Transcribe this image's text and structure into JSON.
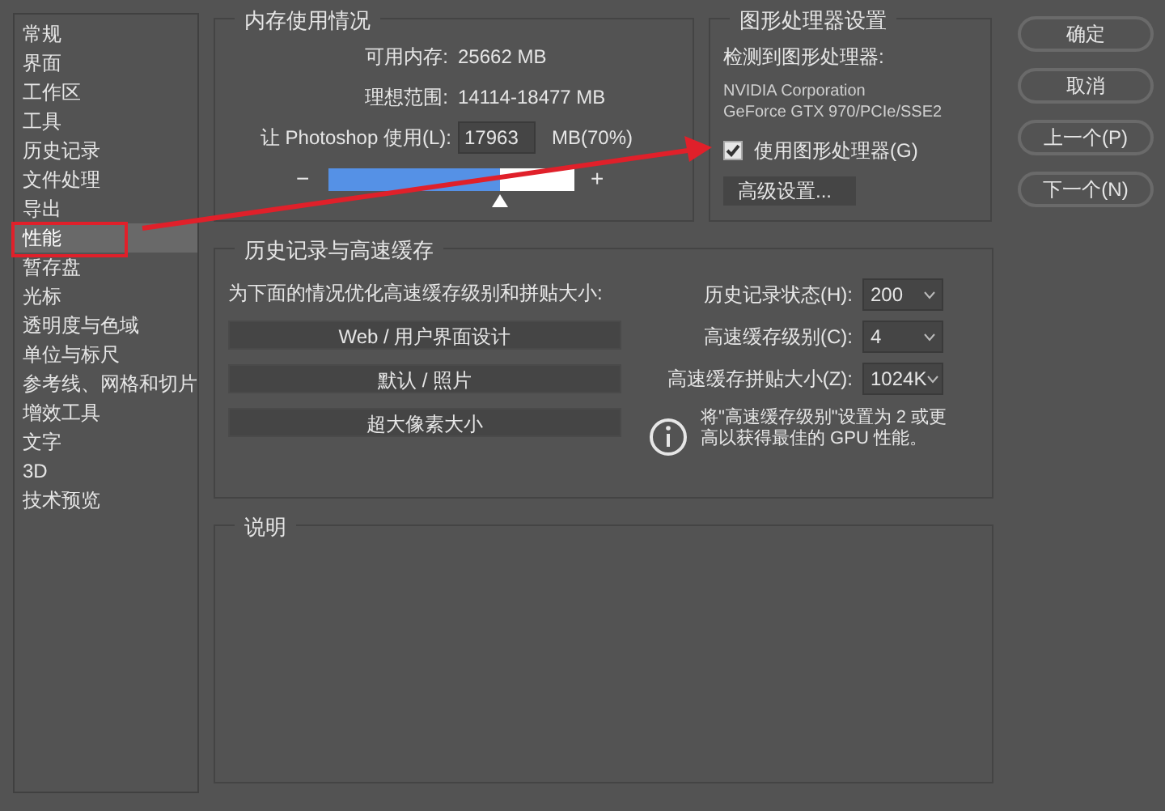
{
  "sidebar": {
    "items": [
      {
        "label": "常规",
        "selected": false
      },
      {
        "label": "界面",
        "selected": false
      },
      {
        "label": "工作区",
        "selected": false
      },
      {
        "label": "工具",
        "selected": false
      },
      {
        "label": "历史记录",
        "selected": false
      },
      {
        "label": "文件处理",
        "selected": false
      },
      {
        "label": "导出",
        "selected": false
      },
      {
        "label": "性能",
        "selected": true
      },
      {
        "label": "暂存盘",
        "selected": false
      },
      {
        "label": "光标",
        "selected": false
      },
      {
        "label": "透明度与色域",
        "selected": false
      },
      {
        "label": "单位与标尺",
        "selected": false
      },
      {
        "label": "参考线、网格和切片",
        "selected": false
      },
      {
        "label": "增效工具",
        "selected": false
      },
      {
        "label": "文字",
        "selected": false
      },
      {
        "label": "3D",
        "selected": false
      },
      {
        "label": "技术预览",
        "selected": false
      }
    ]
  },
  "memory": {
    "title": "内存使用情况",
    "rows": [
      {
        "label": "可用内存:",
        "value": "25662 MB"
      },
      {
        "label": "理想范围:",
        "value": "14114-18477 MB"
      }
    ],
    "use_label": "让 Photoshop 使用(L):",
    "use_value": "17963",
    "use_unit": "MB(70%)",
    "minus": "−",
    "plus": "+",
    "level": 0.7
  },
  "gpu": {
    "title": "图形处理器设置",
    "detected_label": "检测到图形处理器:",
    "vendor": "NVIDIA Corporation",
    "model": "GeForce GTX 970/PCIe/SSE2",
    "use_gpu": {
      "label": "使用图形处理器(G)",
      "checked": true
    },
    "advanced_button": "高级设置..."
  },
  "buttons": [
    "确定",
    "取消",
    "上一个(P)",
    "下一个(N)"
  ],
  "history": {
    "title": "历史记录与高速缓存",
    "optimize_label": "为下面的情况优化高速缓存级别和拼贴大小:",
    "presets": [
      "Web / 用户界面设计",
      "默认 / 照片",
      "超大像素大小"
    ],
    "fields": [
      {
        "label": "历史记录状态(H):",
        "value": "200"
      },
      {
        "label": "高速缓存级别(C):",
        "value": "4"
      },
      {
        "label": "高速缓存拼贴大小(Z):",
        "value": "1024K"
      }
    ],
    "info": "将\"高速缓存级别\"设置为 2 或更高以获得最佳的 GPU 性能。"
  },
  "description": {
    "title": "说明"
  },
  "annotations": {
    "highlight_box": true,
    "arrow": true
  }
}
